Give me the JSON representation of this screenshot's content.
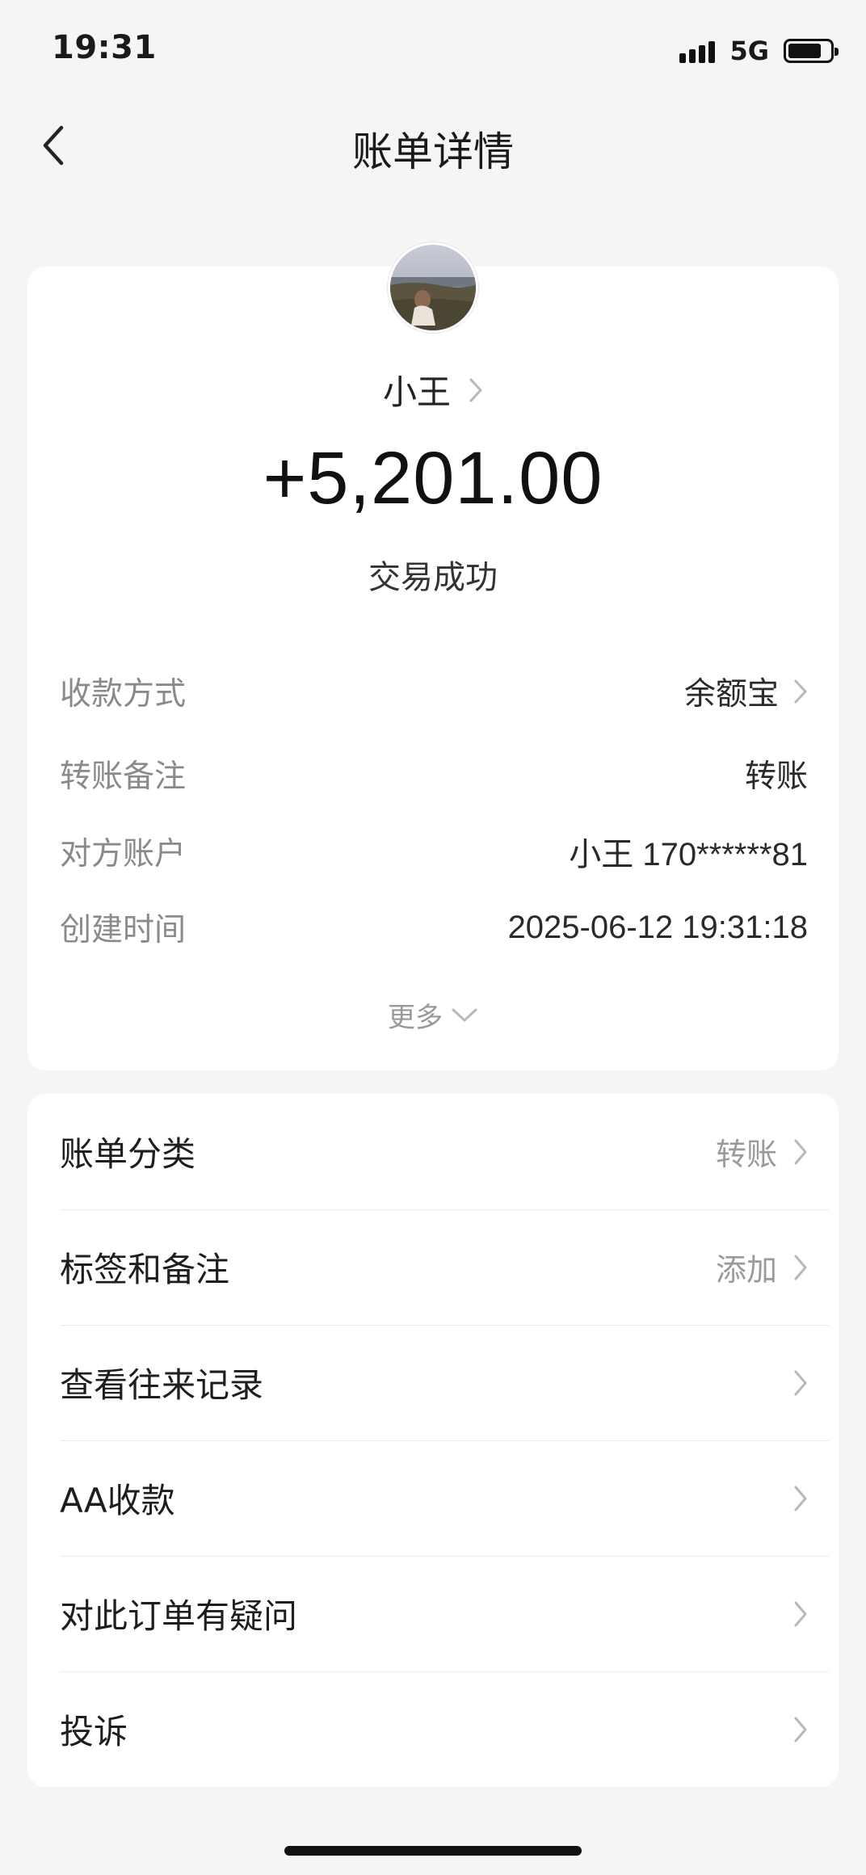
{
  "status_bar": {
    "time": "19:31",
    "network": "5G",
    "battery_level": 0.8
  },
  "nav": {
    "title": "账单详情",
    "back_icon": "chevron-left-icon"
  },
  "payee": {
    "name": "小王",
    "avatar_icon": "user-avatar-photo"
  },
  "transaction": {
    "amount": "+5,201.00",
    "status": "交易成功"
  },
  "details": [
    {
      "label": "收款方式",
      "value": "余额宝",
      "has_arrow": true
    },
    {
      "label": "转账备注",
      "value": "转账",
      "has_arrow": false
    },
    {
      "label": "对方账户",
      "value": "小王 170******81",
      "has_arrow": false
    },
    {
      "label": "创建时间",
      "value": "2025-06-12 19:31:18",
      "has_arrow": false
    }
  ],
  "more": {
    "label": "更多",
    "icon": "chevron-down-icon"
  },
  "menu": [
    {
      "label": "账单分类",
      "value": "转账"
    },
    {
      "label": "标签和备注",
      "value": "添加"
    },
    {
      "label": "查看往来记录",
      "value": ""
    },
    {
      "label": "AA收款",
      "value": ""
    },
    {
      "label": "对此订单有疑问",
      "value": ""
    },
    {
      "label": "投诉",
      "value": ""
    }
  ],
  "colors": {
    "background": "#f5f5f5",
    "card": "#ffffff",
    "label_gray": "#8a8a8a",
    "text_dark": "#1a1a1a"
  }
}
